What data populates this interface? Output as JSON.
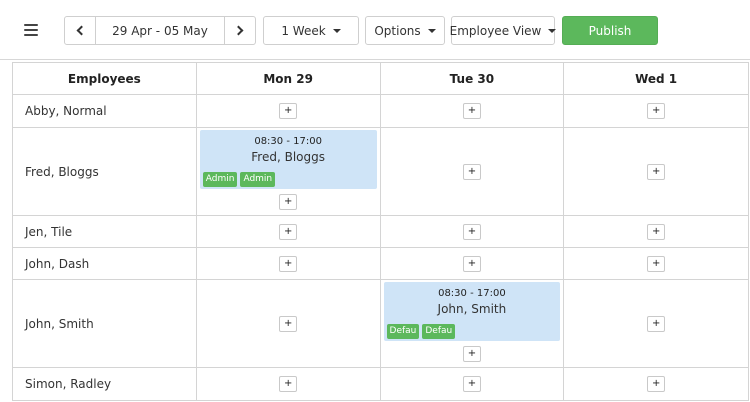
{
  "toolbar": {
    "menu_icon": "hamburger-menu-icon",
    "prev_icon": "chevron-left-icon",
    "next_icon": "chevron-right-icon",
    "date_range": "29 Apr - 05 May",
    "period": "1 Week",
    "options": "Options",
    "view": "Employee View",
    "publish": "Publish"
  },
  "colors": {
    "publish": "#5cb85c",
    "shift_bg": "#cfe4f7",
    "tag_bg": "#5cb85c"
  },
  "grid": {
    "headers": [
      "Employees",
      "Mon 29",
      "Tue 30",
      "Wed 1"
    ],
    "add_label": "+",
    "employees": [
      {
        "name": "Abby, Normal"
      },
      {
        "name": "Fred, Bloggs",
        "shift": {
          "time": "08:30 - 17:00",
          "name": "Fred, Bloggs",
          "tags": [
            "Admin",
            "Admin"
          ]
        }
      },
      {
        "name": "Jen, Tile"
      },
      {
        "name": "John, Dash"
      },
      {
        "name": "John, Smith",
        "shift": {
          "time": "08:30 - 17:00",
          "name": "John, Smith",
          "tags": [
            "Defau",
            "Defau"
          ]
        }
      },
      {
        "name": "Simon, Radley"
      }
    ]
  }
}
